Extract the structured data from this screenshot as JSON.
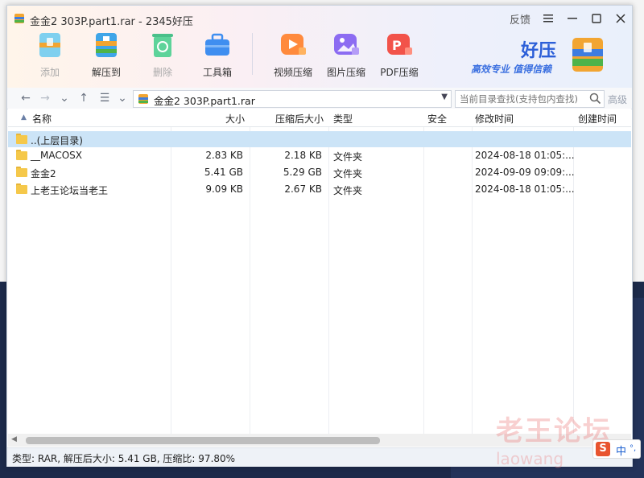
{
  "window": {
    "title": "金金2 303P.part1.rar - 2345好压",
    "feedback": "反馈"
  },
  "toolbar": [
    {
      "label": "添加",
      "icon": "add-archive-icon",
      "disabled": true
    },
    {
      "label": "解压到",
      "icon": "extract-to-icon",
      "disabled": false
    },
    {
      "label": "删除",
      "icon": "delete-recycle-icon",
      "disabled": true
    },
    {
      "label": "工具箱",
      "icon": "toolbox-icon",
      "disabled": false
    },
    {
      "label": "视频压缩",
      "icon": "video-compress-icon",
      "disabled": false
    },
    {
      "label": "图片压缩",
      "icon": "image-compress-icon",
      "disabled": false
    },
    {
      "label": "PDF压缩",
      "icon": "pdf-compress-icon",
      "disabled": false
    }
  ],
  "brand": {
    "name": "好压",
    "slogan": "高效专业  值得信赖"
  },
  "address": {
    "path": "金金2 303P.part1.rar",
    "search_placeholder": "当前目录查找(支持包内查找)",
    "advanced": "高级"
  },
  "columns": [
    "名称",
    "大小",
    "压缩后大小",
    "类型",
    "安全",
    "修改时间",
    "创建时间"
  ],
  "rows": [
    {
      "name": "..(上层目录)",
      "size": "",
      "packed": "",
      "type": "",
      "security": "",
      "modified": "",
      "created": "",
      "selected": true
    },
    {
      "name": "__MACOSX",
      "size": "2.83 KB",
      "packed": "2.18 KB",
      "type": "文件夹",
      "security": "",
      "modified": "2024-08-18 01:05:...",
      "created": ""
    },
    {
      "name": "金金2",
      "size": "5.41 GB",
      "packed": "5.29 GB",
      "type": "文件夹",
      "security": "",
      "modified": "2024-09-09 09:09:...",
      "created": ""
    },
    {
      "name": "上老王论坛当老王",
      "size": "9.09 KB",
      "packed": "2.67 KB",
      "type": "文件夹",
      "security": "",
      "modified": "2024-08-18 01:05:...",
      "created": ""
    }
  ],
  "status": "类型: RAR, 解压后大小: 5.41 GB, 压缩比: 97.80%",
  "watermark": {
    "line1": "老王论坛",
    "line2": "laowang"
  },
  "ime": {
    "char": "S",
    "lang": "中"
  },
  "colors": {
    "selection": "#cce4f7",
    "folder": "#f5c84a",
    "brand": "#2c5fd8"
  }
}
